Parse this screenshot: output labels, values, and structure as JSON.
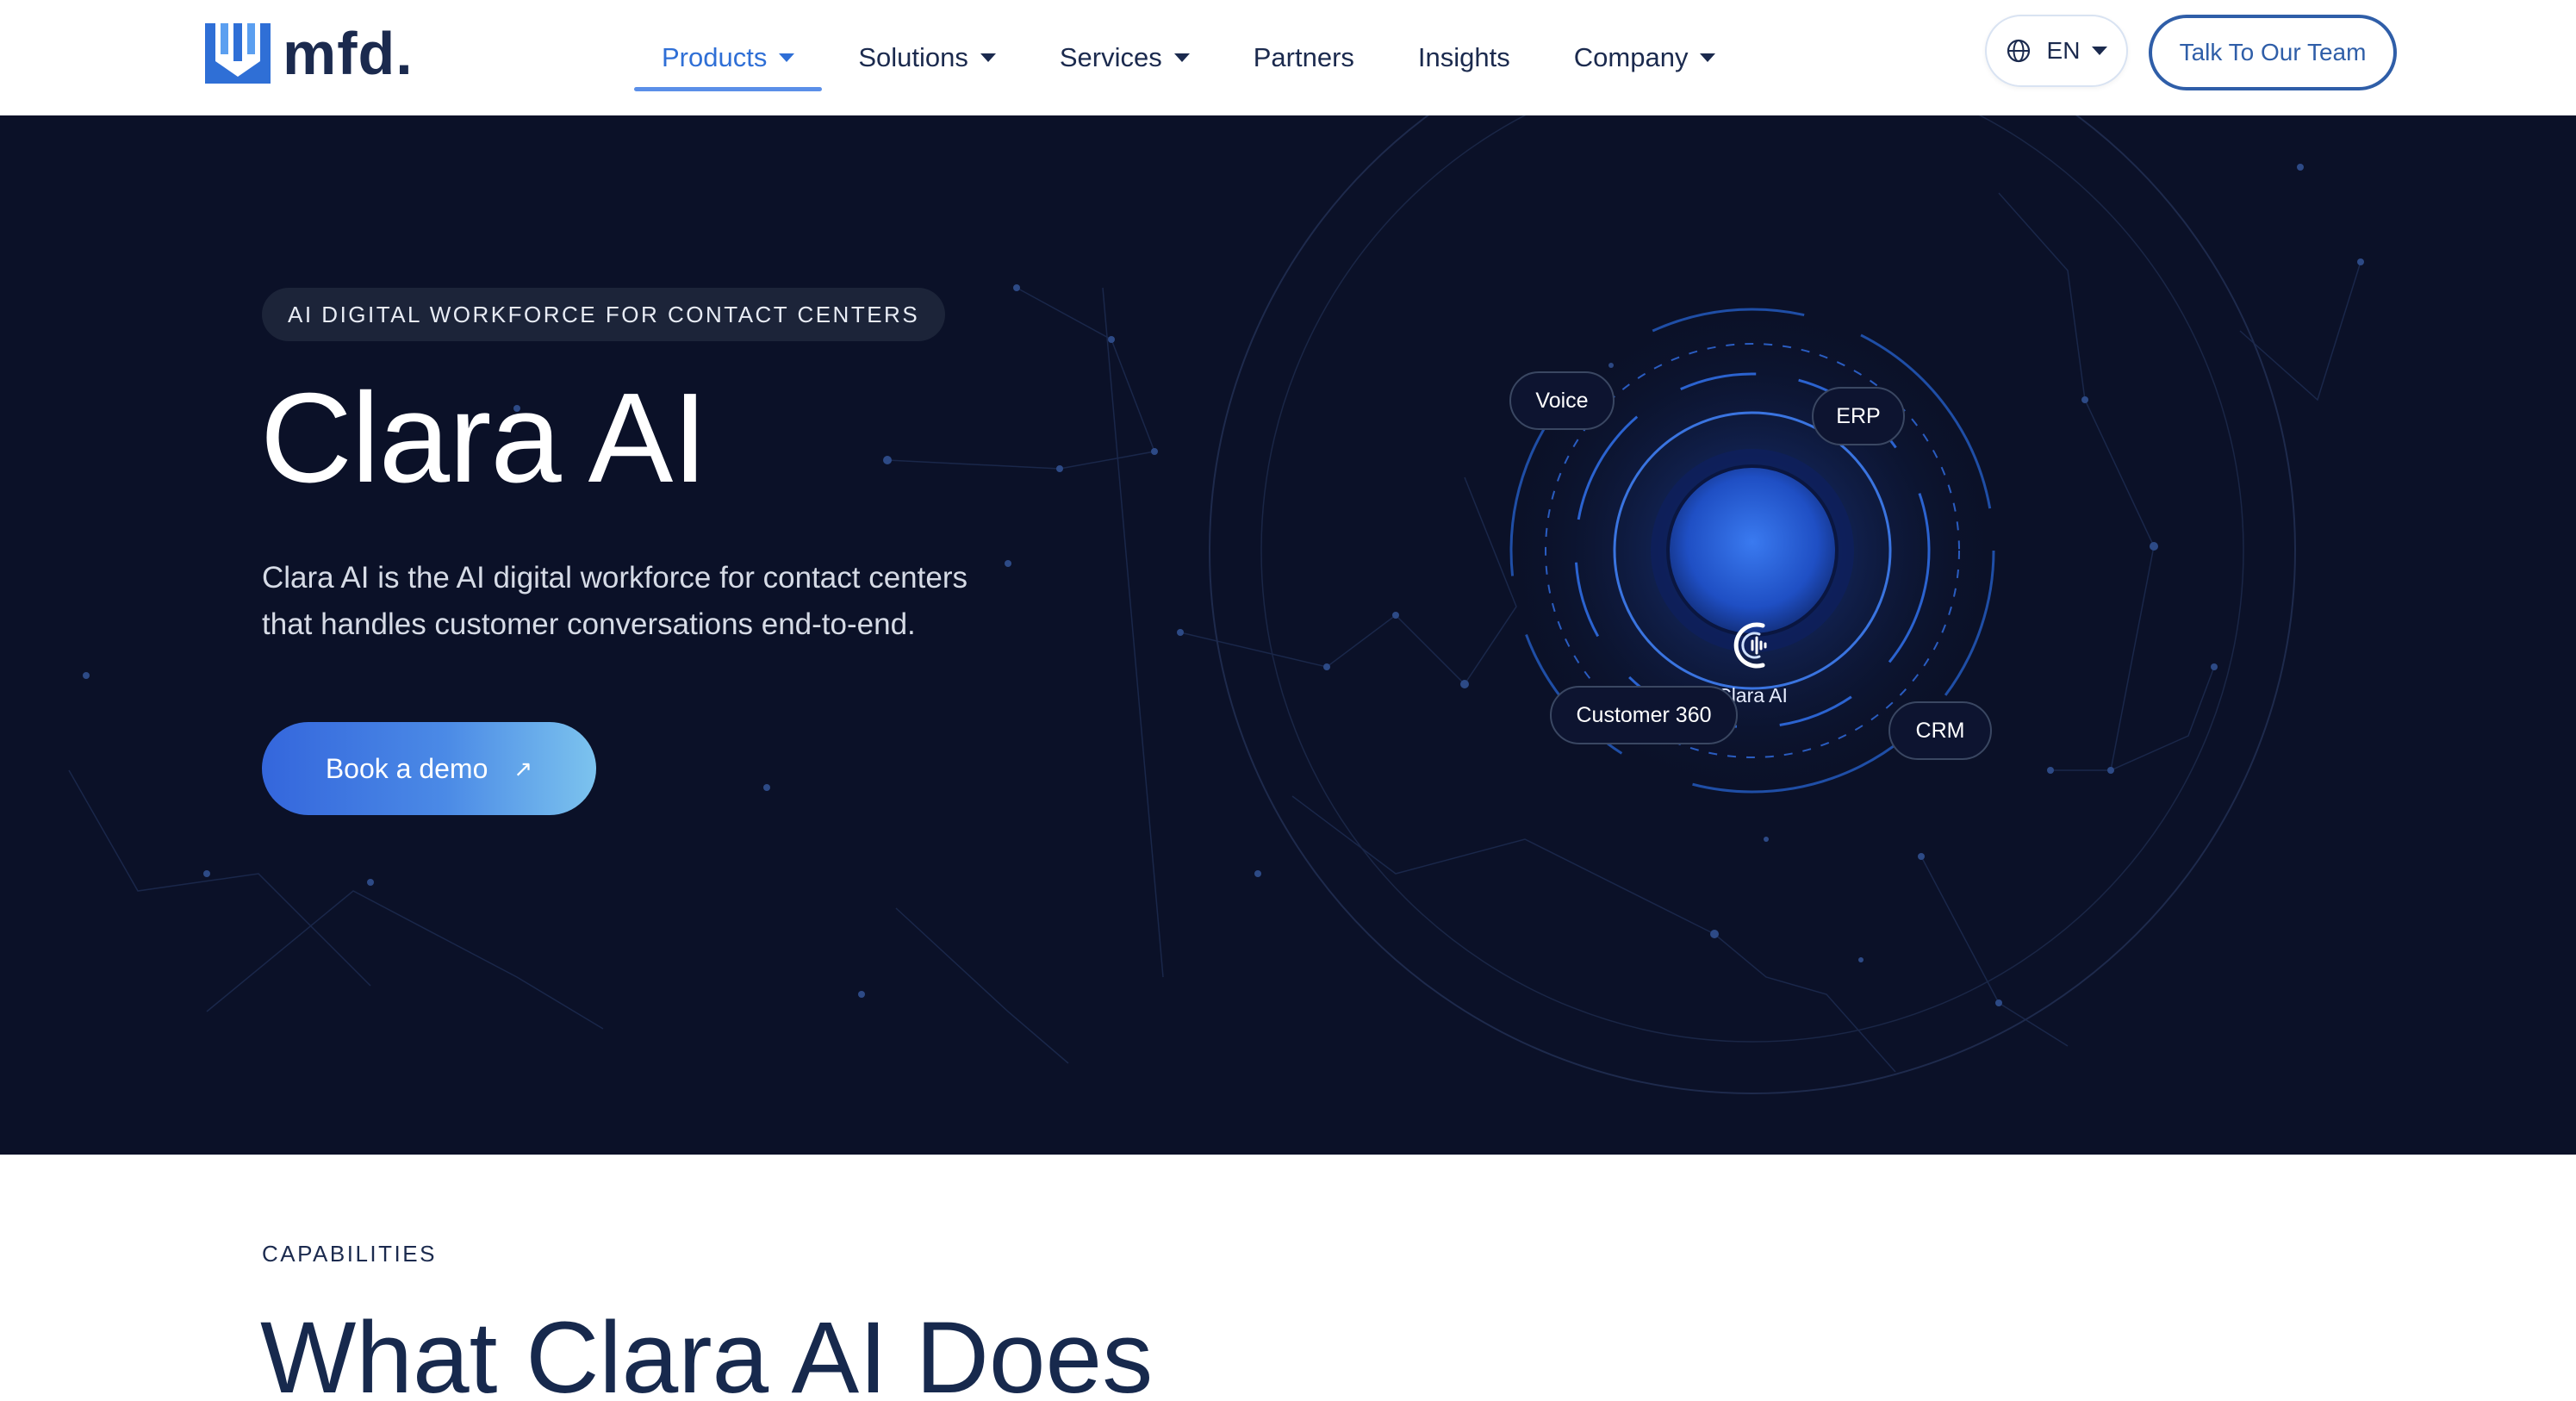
{
  "nav": {
    "logo_text": "mfd.",
    "items": [
      {
        "label": "Products",
        "dropdown": true,
        "active": true
      },
      {
        "label": "Solutions",
        "dropdown": true,
        "active": false
      },
      {
        "label": "Services",
        "dropdown": true,
        "active": false
      },
      {
        "label": "Partners",
        "dropdown": false,
        "active": false
      },
      {
        "label": "Insights",
        "dropdown": false,
        "active": false
      },
      {
        "label": "Company",
        "dropdown": true,
        "active": false
      }
    ],
    "language": "EN",
    "cta_label": "Talk To Our Team"
  },
  "hero": {
    "eyebrow": "AI DIGITAL WORKFORCE FOR CONTACT CENTERS",
    "title": "Clara AI",
    "description_line1": "Clara AI is the AI digital workforce for contact centers",
    "description_line2": "that handles customer conversations end-to-end.",
    "button_label": "Book a demo",
    "button_icon": "arrow-up-right-icon",
    "diagram": {
      "center_label": "Clara AI",
      "nodes": [
        "Voice",
        "ERP",
        "Customer 360",
        "CRM"
      ]
    }
  },
  "capabilities": {
    "label": "CAPABILITIES",
    "title": "What Clara AI Does"
  },
  "colors": {
    "hero_bg": "#0b1128",
    "accent": "#2f6fd6",
    "button_gradient_start": "#3466dc",
    "button_gradient_end": "#7cc3ee",
    "heading_dark": "#17294d"
  }
}
